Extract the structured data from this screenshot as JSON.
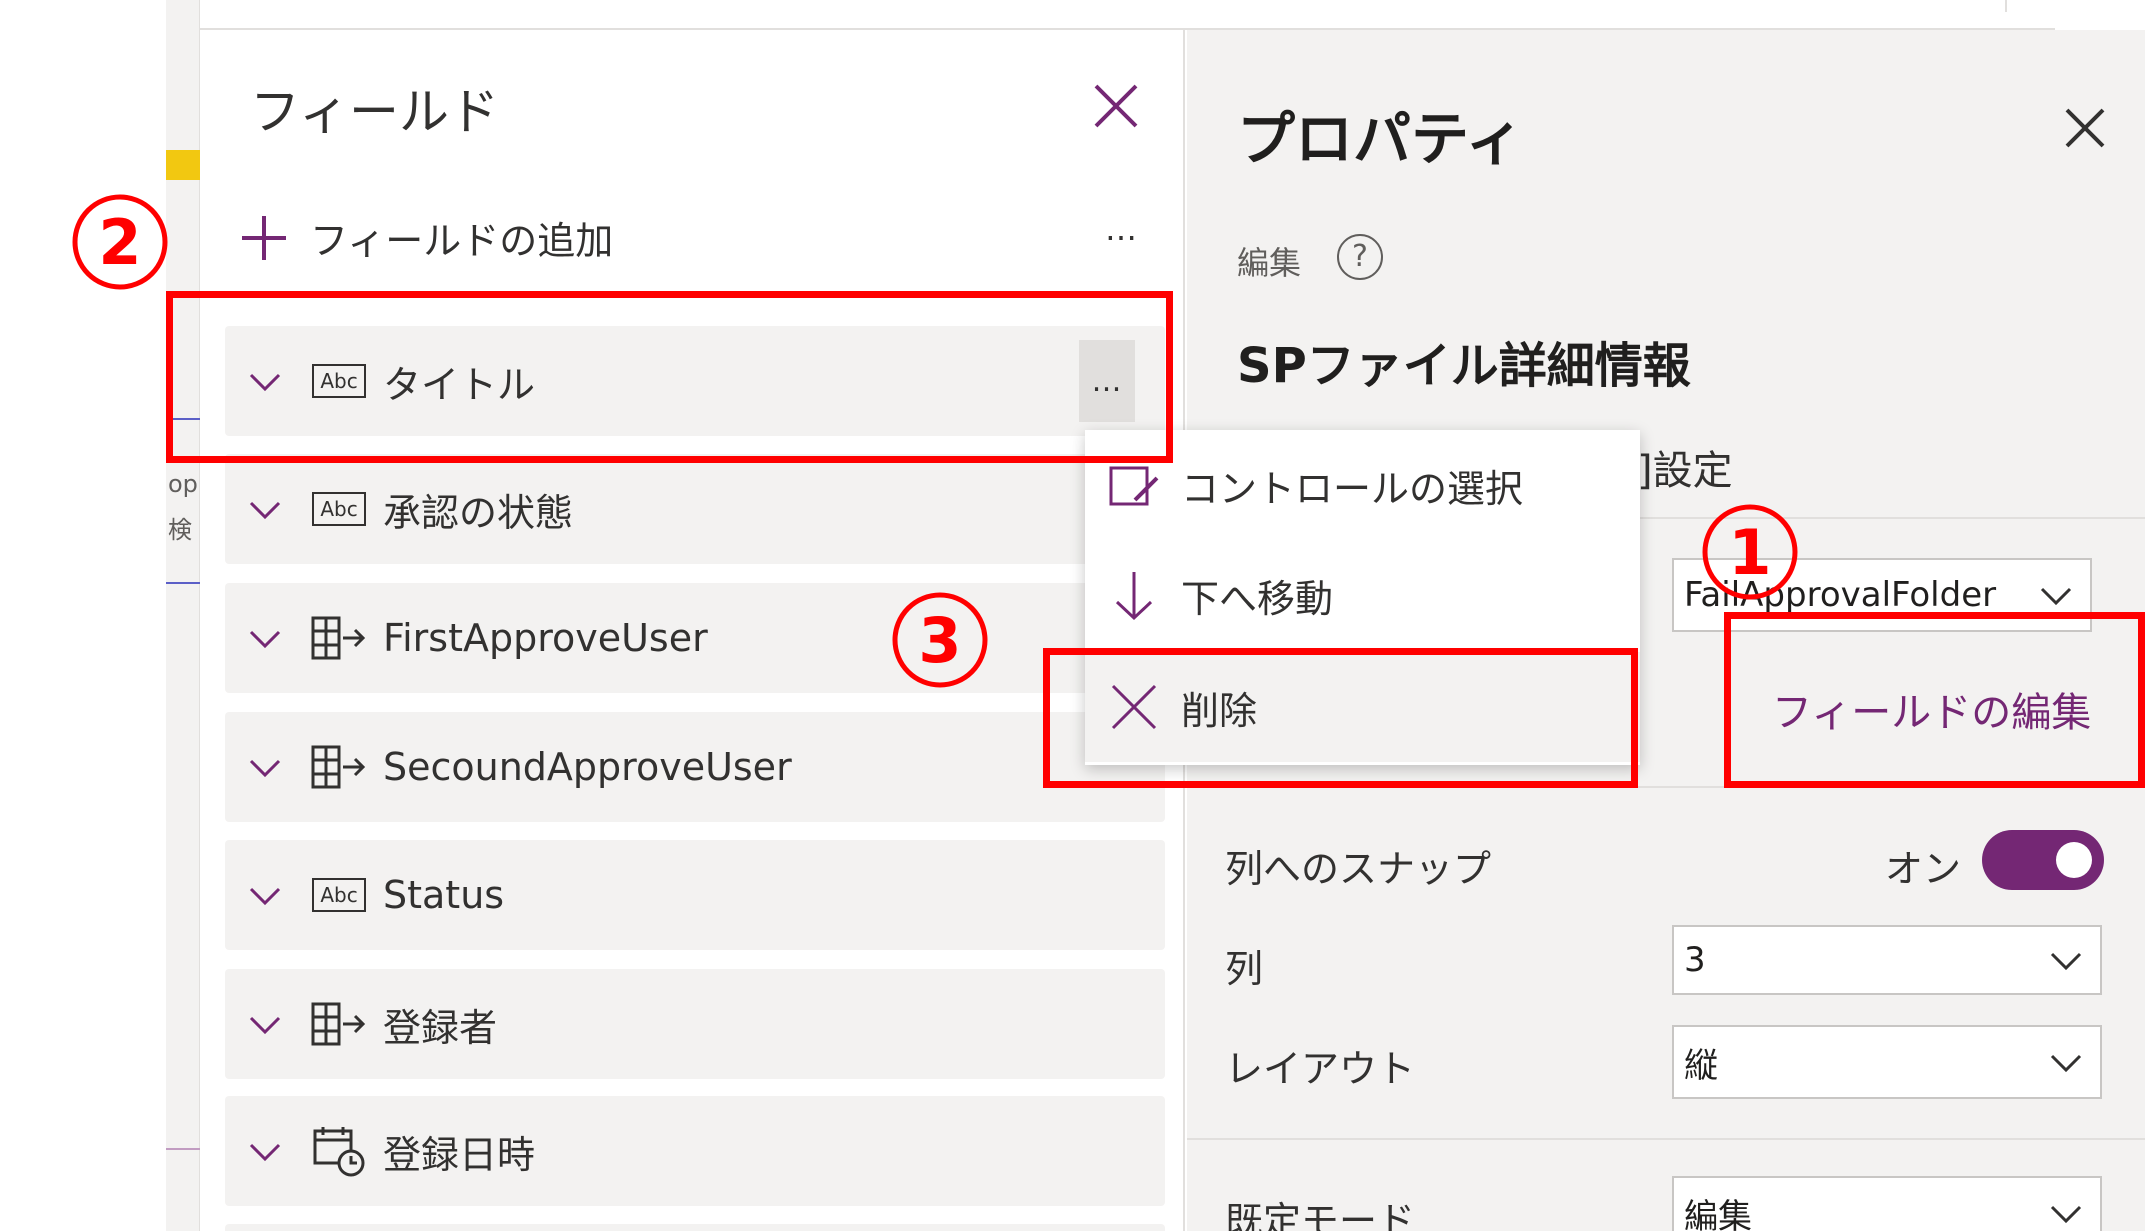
{
  "fields_panel": {
    "title": "フィールド",
    "add_label": "フィールドの追加",
    "more_label": "…",
    "fields": [
      {
        "icon": "text-abc-icon",
        "icon_text": "Abc",
        "label": "タイトル"
      },
      {
        "icon": "text-abc-icon",
        "icon_text": "Abc",
        "label": "承認の状態"
      },
      {
        "icon": "person-lookup-icon",
        "label": "FirstApproveUser"
      },
      {
        "icon": "person-lookup-icon",
        "label": "SecoundApproveUser"
      },
      {
        "icon": "text-abc-icon",
        "icon_text": "Abc",
        "label": "Status"
      },
      {
        "icon": "person-lookup-icon",
        "label": "登録者"
      },
      {
        "icon": "calendar-clock-icon",
        "label": "登録日時"
      }
    ]
  },
  "context_menu": {
    "items": [
      {
        "icon": "edit-control-icon",
        "label": "コントロールの選択"
      },
      {
        "icon": "arrow-down-icon",
        "label": "下へ移動"
      },
      {
        "icon": "close-x-icon",
        "label": "削除"
      }
    ]
  },
  "properties_panel": {
    "title": "プロパティ",
    "edit_label": "編集",
    "help_symbol": "?",
    "form_name": "SPファイル詳細情報",
    "tab_partial": "]設定",
    "data_source_value": "FailApprovalFolder",
    "edit_fields_link": "フィールドの編集",
    "snap_label": "列へのスナップ",
    "snap_state": "オン",
    "columns_label": "列",
    "columns_value": "3",
    "layout_label": "レイアウト",
    "layout_value": "縦",
    "default_mode_label": "既定モード",
    "default_mode_value": "編集"
  },
  "canvas_strip": {
    "text_1": "opr",
    "text_2": "検"
  },
  "annotations": {
    "marker_1": "1",
    "marker_2": "2",
    "marker_3": "3"
  },
  "colors": {
    "accent": "#742774",
    "annotation": "#ff0000",
    "panel_bg": "#f3f2f1"
  }
}
